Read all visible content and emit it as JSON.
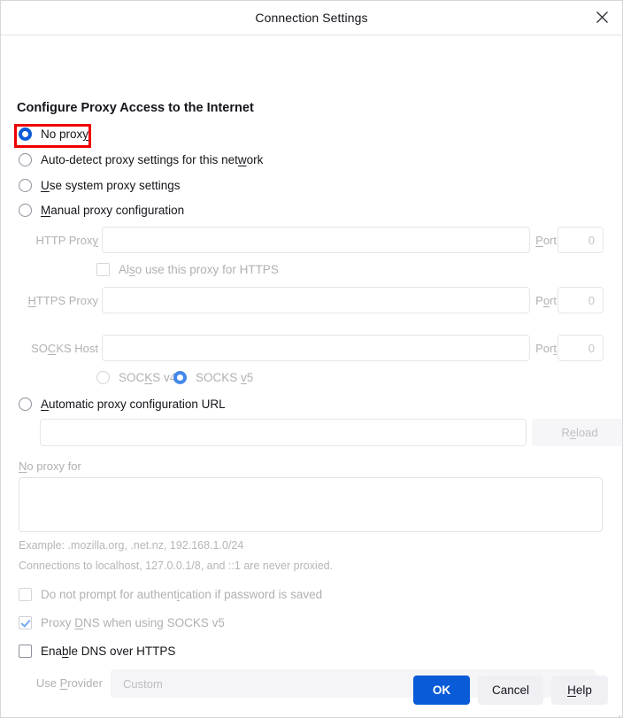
{
  "window": {
    "title": "Connection Settings",
    "close_icon": "close-icon"
  },
  "heading": "Configure Proxy Access to the Internet",
  "proxy_modes": [
    {
      "label": "No proxy",
      "accel": "y",
      "selected": true,
      "highlighted": true
    },
    {
      "label": "Auto-detect proxy settings for this network",
      "accel": "w",
      "selected": false
    },
    {
      "label": "Use system proxy settings",
      "accel": "U",
      "selected": false
    },
    {
      "label": "Manual proxy configuration",
      "accel": "M",
      "selected": false
    },
    {
      "label": "Automatic proxy configuration URL",
      "accel": "A",
      "selected": false
    }
  ],
  "manual": {
    "http_label": "HTTP Proxy",
    "http_value": "",
    "http_port_label": "Port",
    "http_port_value": "0",
    "also_https_label": "Also use this proxy for HTTPS",
    "also_https_checked": false,
    "https_label": "HTTPS Proxy",
    "https_value": "",
    "https_port_label": "Port",
    "https_port_value": "0",
    "socks_label": "SOCKS Host",
    "socks_value": "",
    "socks_port_label": "Port",
    "socks_port_value": "0",
    "socks_v4_label": "SOCKS v4",
    "socks_v5_label": "SOCKS v5",
    "socks_version_selected": "SOCKS v5"
  },
  "pac": {
    "url_value": "",
    "reload_label": "Reload"
  },
  "no_proxy": {
    "label": "No proxy for",
    "value": "",
    "example_note": "Example: .mozilla.org, .net.nz, 192.168.1.0/24",
    "localhost_note": "Connections to localhost, 127.0.0.1/8, and ::1 are never proxied."
  },
  "options": [
    {
      "label": "Do not prompt for authentication if password is saved",
      "checked": false,
      "enabled": false
    },
    {
      "label": "Proxy DNS when using SOCKS v5",
      "checked": true,
      "enabled": false
    }
  ],
  "doh": {
    "enable_label": "Enable DNS over HTTPS",
    "enable_checked": false,
    "provider_label": "Use Provider",
    "provider_value": "Custom"
  },
  "footer": {
    "ok": "OK",
    "cancel": "Cancel",
    "help": "Help"
  },
  "colors": {
    "accent": "#0a5bd8",
    "annotation": "#ee0000",
    "text": "#15141a",
    "disabled_text": "#b1b1b5"
  }
}
